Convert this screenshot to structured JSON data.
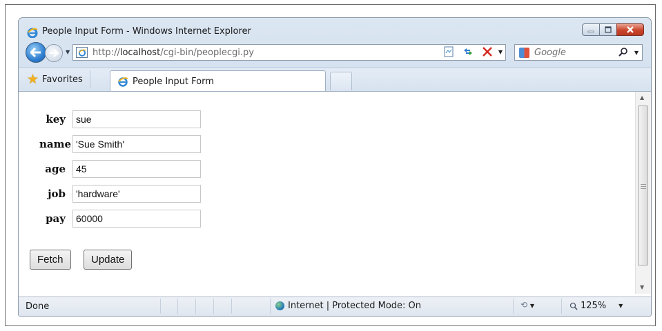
{
  "window": {
    "title": "People Input Form - Windows Internet Explorer"
  },
  "nav": {
    "url_prefix": "http://",
    "url_host": "localhost",
    "url_path": "/cgi-bin/peoplecgi.py",
    "search_placeholder": "Google"
  },
  "tabs": {
    "favorites_label": "Favorites",
    "active_tab_label": "People Input Form"
  },
  "form": {
    "fields": [
      {
        "label": "key",
        "value": "sue"
      },
      {
        "label": "name",
        "value": "'Sue Smith'"
      },
      {
        "label": "age",
        "value": "45"
      },
      {
        "label": "job",
        "value": "'hardware'"
      },
      {
        "label": "pay",
        "value": "60000"
      }
    ],
    "fetch_label": "Fetch",
    "update_label": "Update"
  },
  "status": {
    "text": "Done",
    "zone": "Internet | Protected Mode: On",
    "zoom": "125%"
  },
  "icons": {
    "ie": "ie-logo-icon",
    "back": "back-arrow-icon",
    "forward": "forward-arrow-icon",
    "compat": "compatibility-view-icon",
    "refresh": "refresh-icon",
    "stop": "stop-icon",
    "search": "search-icon",
    "star": "favorites-star-icon",
    "globe": "internet-globe-icon",
    "security": "security-status-icon",
    "zoom": "zoom-magnifier-icon"
  },
  "colors": {
    "close_button": "#c9452c",
    "nav_button": "#2f7fd0",
    "stop_x": "#d42a22",
    "favorites_star": "#f0b020"
  }
}
